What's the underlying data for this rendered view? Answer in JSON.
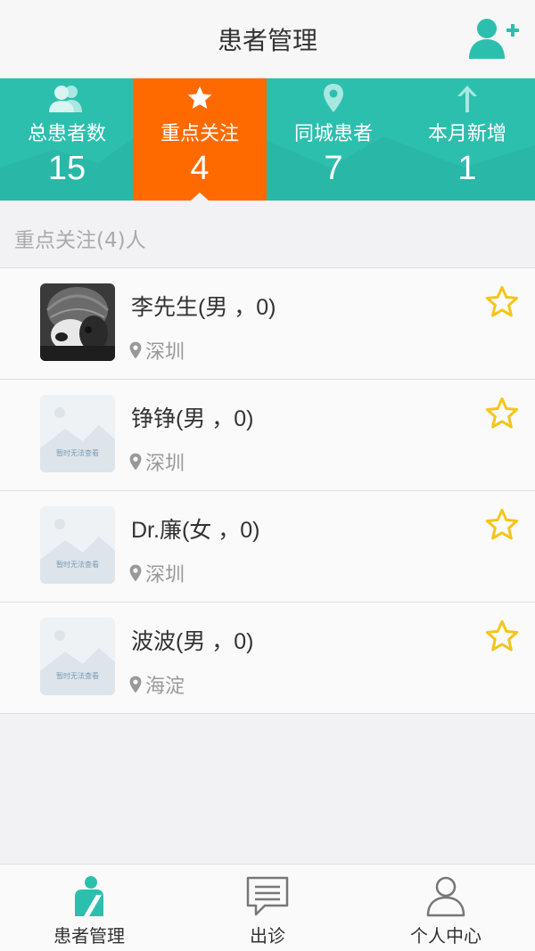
{
  "header": {
    "title": "患者管理",
    "add_icon": "add-user-icon"
  },
  "stats": [
    {
      "label": "总患者数",
      "value": "15",
      "icon": "users-icon",
      "active": false
    },
    {
      "label": "重点关注",
      "value": "4",
      "icon": "star-icon",
      "active": true
    },
    {
      "label": "同城患者",
      "value": "7",
      "icon": "location-pin-icon",
      "active": false
    },
    {
      "label": "本月新增",
      "value": "1",
      "icon": "arrow-up-icon",
      "active": false
    }
  ],
  "section_title": "重点关注(4)人",
  "patients": [
    {
      "name": "李先生(男 ，0)",
      "location": "深圳",
      "avatar": "photo",
      "starred": true
    },
    {
      "name": "铮铮(男 ，0)",
      "location": "深圳",
      "avatar": "placeholder",
      "placeholder_text": "暂时无法查看",
      "starred": true
    },
    {
      "name": "Dr.廉(女 ，0)",
      "location": "深圳",
      "avatar": "placeholder",
      "placeholder_text": "暂时无法查看",
      "starred": true
    },
    {
      "name": "波波(男 ，0)",
      "location": "海淀",
      "avatar": "placeholder",
      "placeholder_text": "暂时无法查看",
      "starred": true
    }
  ],
  "tabbar": [
    {
      "label": "患者管理",
      "icon": "patient-management-icon",
      "active": true
    },
    {
      "label": "出诊",
      "icon": "chat-icon",
      "active": false
    },
    {
      "label": "个人中心",
      "icon": "person-icon",
      "active": false
    }
  ],
  "colors": {
    "accent_teal": "#2dbfae",
    "active_orange": "#ff6a00",
    "star_yellow": "#f5c518"
  }
}
